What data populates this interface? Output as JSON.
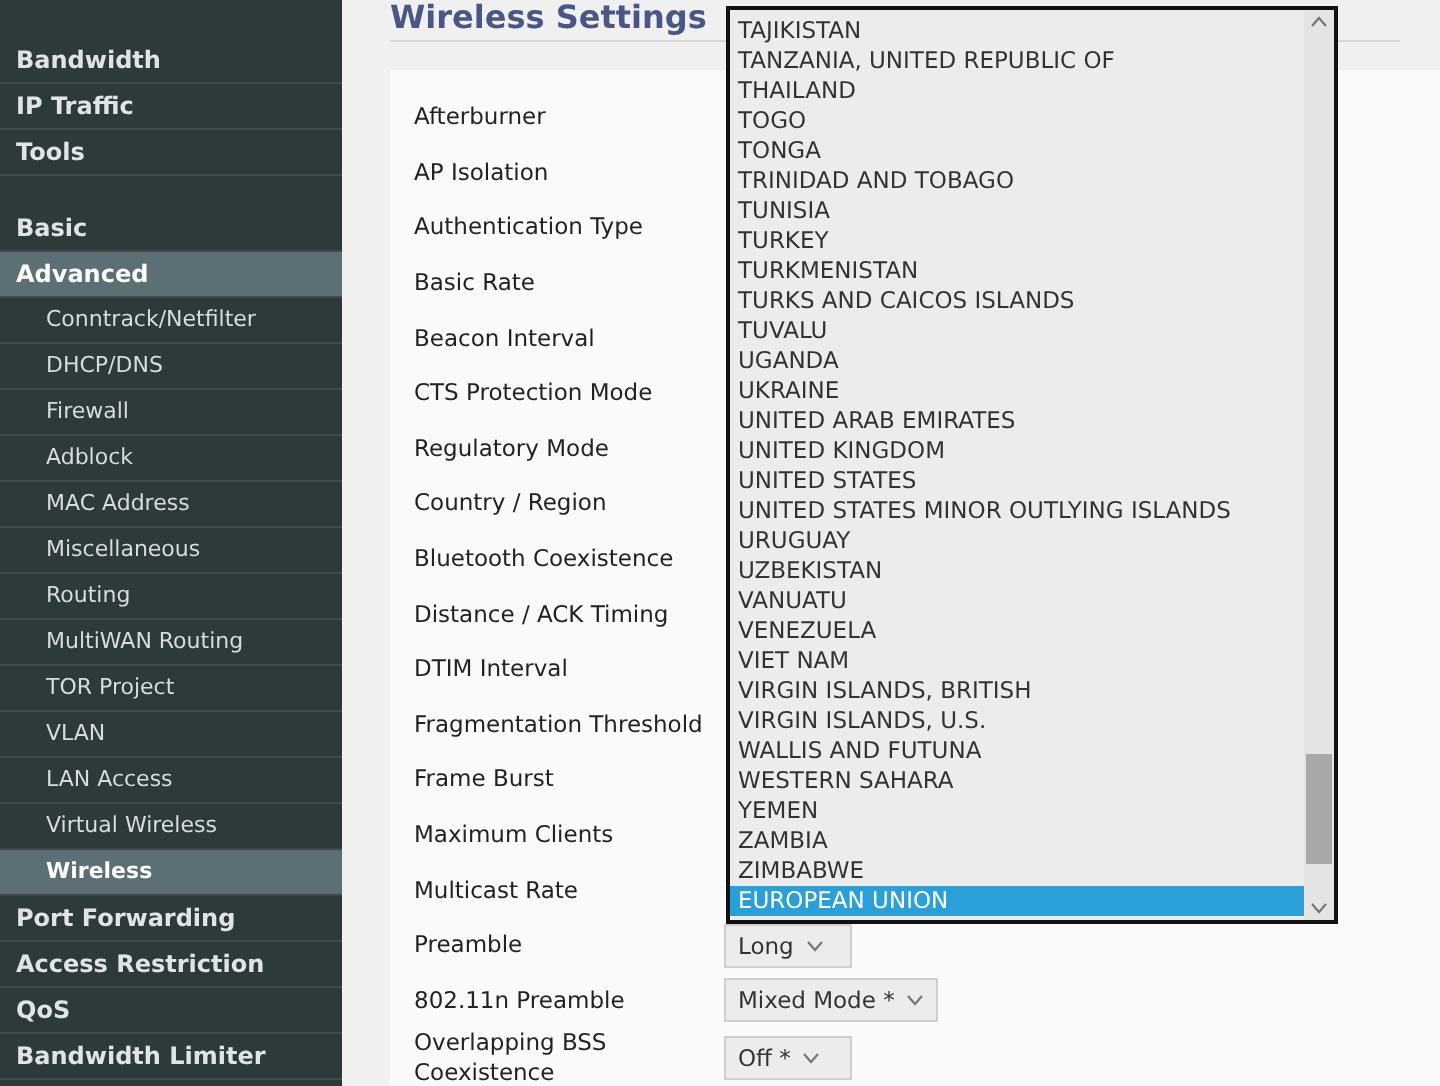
{
  "sidebar": {
    "items": [
      {
        "label": "Bandwidth",
        "kind": "top",
        "selected": false
      },
      {
        "label": "IP Traffic",
        "kind": "top",
        "selected": false
      },
      {
        "label": "Tools",
        "kind": "top",
        "selected": false
      },
      {
        "label": "Basic",
        "kind": "top",
        "selected": false,
        "gap_before": true
      },
      {
        "label": "Advanced",
        "kind": "top",
        "selected": true
      },
      {
        "label": "Conntrack/Netfilter",
        "kind": "sub",
        "selected": false
      },
      {
        "label": "DHCP/DNS",
        "kind": "sub",
        "selected": false
      },
      {
        "label": "Firewall",
        "kind": "sub",
        "selected": false
      },
      {
        "label": "Adblock",
        "kind": "sub",
        "selected": false
      },
      {
        "label": "MAC Address",
        "kind": "sub",
        "selected": false
      },
      {
        "label": "Miscellaneous",
        "kind": "sub",
        "selected": false
      },
      {
        "label": "Routing",
        "kind": "sub",
        "selected": false
      },
      {
        "label": "MultiWAN Routing",
        "kind": "sub",
        "selected": false
      },
      {
        "label": "TOR Project",
        "kind": "sub",
        "selected": false
      },
      {
        "label": "VLAN",
        "kind": "sub",
        "selected": false
      },
      {
        "label": "LAN Access",
        "kind": "sub",
        "selected": false
      },
      {
        "label": "Virtual Wireless",
        "kind": "sub",
        "selected": false
      },
      {
        "label": "Wireless",
        "kind": "sub",
        "selected": true
      },
      {
        "label": "Port Forwarding",
        "kind": "top",
        "selected": false
      },
      {
        "label": "Access Restriction",
        "kind": "top",
        "selected": false
      },
      {
        "label": "QoS",
        "kind": "top",
        "selected": false
      },
      {
        "label": "Bandwidth Limiter",
        "kind": "top",
        "selected": false
      }
    ]
  },
  "page": {
    "title": "Wireless Settings"
  },
  "settings": [
    {
      "label": "Afterburner"
    },
    {
      "label": "AP Isolation"
    },
    {
      "label": "Authentication Type"
    },
    {
      "label": "Basic Rate"
    },
    {
      "label": "Beacon Interval"
    },
    {
      "label": "CTS Protection Mode"
    },
    {
      "label": "Regulatory Mode"
    },
    {
      "label": "Country / Region"
    },
    {
      "label": "Bluetooth Coexistence"
    },
    {
      "label": "Distance / ACK Timing"
    },
    {
      "label": "DTIM Interval"
    },
    {
      "label": "Fragmentation Threshold"
    },
    {
      "label": "Frame Burst"
    },
    {
      "label": "Maximum Clients"
    },
    {
      "label": "Multicast Rate"
    },
    {
      "label": "Preamble",
      "value": "Long"
    },
    {
      "label": "802.11n Preamble",
      "value": "Mixed Mode *"
    },
    {
      "label": "Overlapping BSS Coexistence",
      "value": "Off *"
    }
  ],
  "country_dropdown": {
    "options": [
      {
        "label": "TAJIKISTAN",
        "selected": false
      },
      {
        "label": "TANZANIA, UNITED REPUBLIC OF",
        "selected": false
      },
      {
        "label": "THAILAND",
        "selected": false
      },
      {
        "label": "TOGO",
        "selected": false
      },
      {
        "label": "TONGA",
        "selected": false
      },
      {
        "label": "TRINIDAD AND TOBAGO",
        "selected": false
      },
      {
        "label": "TUNISIA",
        "selected": false
      },
      {
        "label": "TURKEY",
        "selected": false
      },
      {
        "label": "TURKMENISTAN",
        "selected": false
      },
      {
        "label": "TURKS AND CAICOS ISLANDS",
        "selected": false
      },
      {
        "label": "TUVALU",
        "selected": false
      },
      {
        "label": "UGANDA",
        "selected": false
      },
      {
        "label": "UKRAINE",
        "selected": false
      },
      {
        "label": "UNITED ARAB EMIRATES",
        "selected": false
      },
      {
        "label": "UNITED KINGDOM",
        "selected": false
      },
      {
        "label": "UNITED STATES",
        "selected": false
      },
      {
        "label": "UNITED STATES MINOR OUTLYING ISLANDS",
        "selected": false
      },
      {
        "label": "URUGUAY",
        "selected": false
      },
      {
        "label": "UZBEKISTAN",
        "selected": false
      },
      {
        "label": "VANUATU",
        "selected": false
      },
      {
        "label": "VENEZUELA",
        "selected": false
      },
      {
        "label": "VIET NAM",
        "selected": false
      },
      {
        "label": "VIRGIN ISLANDS, BRITISH",
        "selected": false
      },
      {
        "label": "VIRGIN ISLANDS, U.S.",
        "selected": false
      },
      {
        "label": "WALLIS AND FUTUNA",
        "selected": false
      },
      {
        "label": "WESTERN SAHARA",
        "selected": false
      },
      {
        "label": "YEMEN",
        "selected": false
      },
      {
        "label": "ZAMBIA",
        "selected": false
      },
      {
        "label": "ZIMBABWE",
        "selected": false
      },
      {
        "label": "EUROPEAN UNION",
        "selected": true
      }
    ]
  }
}
